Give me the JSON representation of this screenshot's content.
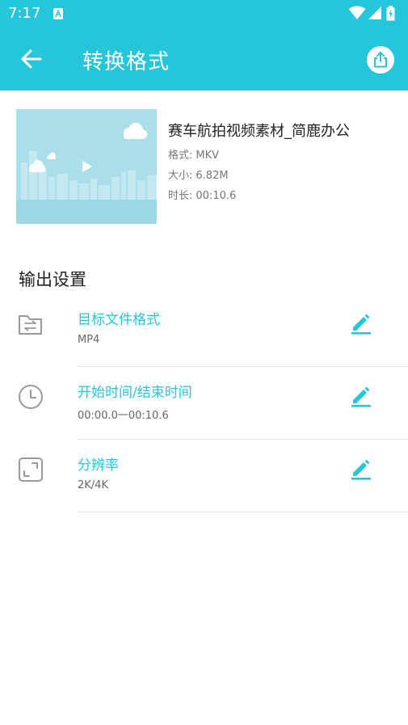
{
  "status_bar": {
    "time": "7:17",
    "icons": [
      "a-notification-icon",
      "wifi-icon",
      "cell-signal-icon",
      "battery-icon"
    ]
  },
  "app_bar": {
    "title": "转换格式",
    "back_icon": "arrow-left-icon",
    "share_icon": "share-icon"
  },
  "media": {
    "title": "赛车航拍视频素材_简鹿办公",
    "format_label": "格式:",
    "format_value": "MKV",
    "size_label": "大小:",
    "size_value": "6.82M",
    "duration_label": "时长:",
    "duration_value": "00:10.6"
  },
  "output_settings": {
    "title": "输出设置",
    "items": [
      {
        "label": "目标文件格式",
        "value": "MP4",
        "icon": "folder-swap-icon"
      },
      {
        "label": "开始时间/结束时间",
        "value": "00:00.0一00:10.6",
        "icon": "clock-icon"
      },
      {
        "label": "分辨率",
        "value": "2K/4K",
        "icon": "resize-icon"
      }
    ]
  },
  "colors": {
    "accent": "#26C6DA",
    "thumbnail_bg": "#A9DEEA"
  }
}
